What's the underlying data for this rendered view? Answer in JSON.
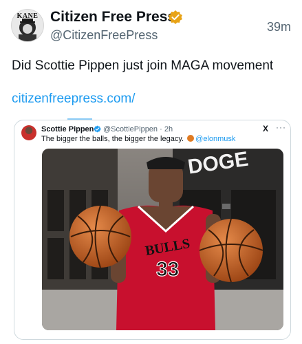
{
  "post": {
    "author_name": "Citizen Free Press",
    "author_handle": "@CitizenFreePress",
    "avatar_text": "KANE",
    "time": "39m",
    "text": "Did Scottie Pippen just join MAGA movement",
    "link": "citizenfreepress.com/"
  },
  "quoted": {
    "author_name": "Scottie Pippen",
    "author_handle": "@ScottiePippen",
    "separator": "·",
    "time": "2h",
    "text": "The bigger the balls, the bigger the legacy.",
    "mention": "@elonmusk",
    "x_label": "X",
    "more_label": "···",
    "image": {
      "sign_text": "DOGE",
      "jersey_text": "BULLS",
      "jersey_number": "33"
    }
  },
  "colors": {
    "accent": "#1d9bf0",
    "verified_gold": "#e8a317",
    "secondary_text": "#536471",
    "jersey_red": "#c8102e"
  }
}
